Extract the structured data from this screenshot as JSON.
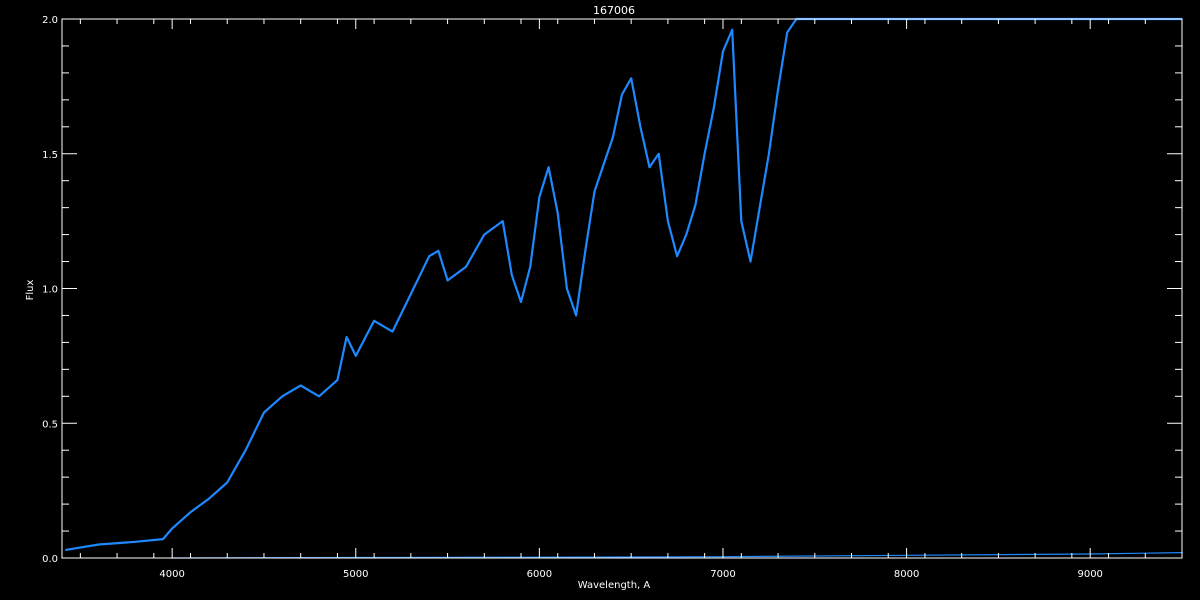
{
  "chart_data": {
    "type": "line",
    "title": "167006",
    "xlabel": "Wavelength, A",
    "ylabel": "Flux",
    "xlim": [
      3400,
      9500
    ],
    "ylim": [
      0.0,
      2.0
    ],
    "xticks": [
      4000,
      5000,
      6000,
      7000,
      8000,
      9000
    ],
    "xtick_labels": [
      "4000",
      "5000",
      "6000",
      "7000",
      "8000",
      "9000"
    ],
    "yticks": [
      0.0,
      0.5,
      1.0,
      1.5,
      2.0
    ],
    "ytick_labels": [
      "0.0",
      "0.5",
      "1.0",
      "1.5",
      "2.0"
    ],
    "grid": false,
    "colors": {
      "background": "#000000",
      "axes": "#ffffff",
      "series": "#1e88ff"
    },
    "series": [
      {
        "x": [
          3420,
          3600,
          3800,
          3950,
          4000,
          4100,
          4200,
          4300,
          4400,
          4500,
          4600,
          4700,
          4800,
          4900,
          4950,
          5000,
          5100,
          5200,
          5300,
          5400,
          5450,
          5500,
          5600,
          5700,
          5800,
          5850,
          5900,
          5950,
          6000,
          6050,
          6100,
          6150,
          6200,
          6250,
          6300,
          6350,
          6400,
          6450,
          6500,
          6550,
          6600,
          6650,
          6700,
          6750,
          6800,
          6850,
          6900,
          6950,
          7000,
          7050,
          7100,
          7150,
          7200,
          7250,
          7300,
          7350,
          7400,
          7500,
          8000,
          8500,
          9000,
          9500
        ],
        "y": [
          0.03,
          0.05,
          0.06,
          0.07,
          0.11,
          0.17,
          0.22,
          0.28,
          0.4,
          0.54,
          0.6,
          0.64,
          0.6,
          0.66,
          0.82,
          0.75,
          0.88,
          0.84,
          0.98,
          1.12,
          1.14,
          1.03,
          1.08,
          1.2,
          1.25,
          1.05,
          0.95,
          1.08,
          1.34,
          1.45,
          1.28,
          1.0,
          0.9,
          1.14,
          1.36,
          1.46,
          1.56,
          1.72,
          1.78,
          1.6,
          1.45,
          1.5,
          1.25,
          1.12,
          1.2,
          1.31,
          1.5,
          1.67,
          1.88,
          1.96,
          1.25,
          1.1,
          1.3,
          1.5,
          1.74,
          1.95,
          2.0,
          2.0,
          2.0,
          2.0,
          2.0,
          2.0
        ]
      },
      {
        "x": [
          4000,
          5000,
          6000,
          7000,
          8000,
          9000,
          9500
        ],
        "y": [
          0.0,
          0.002,
          0.003,
          0.005,
          0.01,
          0.015,
          0.02
        ]
      }
    ]
  }
}
